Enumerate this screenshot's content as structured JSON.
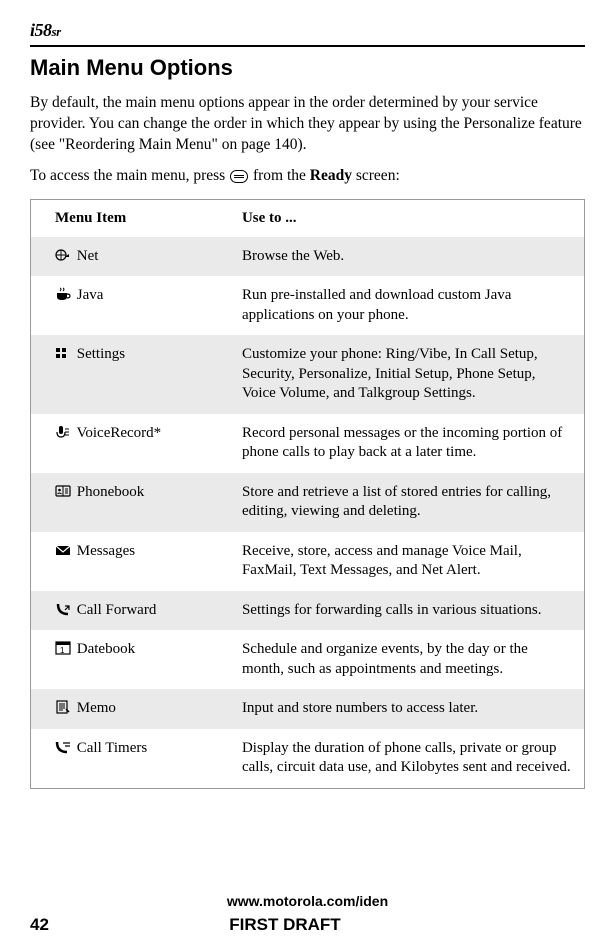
{
  "logo": {
    "main": "i58",
    "suffix": "sr"
  },
  "section_title": "Main Menu Options",
  "intro": "By default, the main menu options appear in the order determined by your service provider. You can change the order in which they appear by using the Personalize feature (see \"Reordering Main Menu\" on page 140).",
  "access_pre": "To access the main menu, press ",
  "access_post": " from the ",
  "access_bold": "Ready",
  "access_tail": " screen:",
  "table": {
    "head_item": "Menu Item",
    "head_use": "Use to ...",
    "rows": [
      {
        "label": "Net",
        "desc": "Browse the Web."
      },
      {
        "label": "Java",
        "desc": "Run pre-installed and download custom Java applications on your phone."
      },
      {
        "label": "Settings",
        "desc": "Customize your phone: Ring/Vibe, In Call Setup, Security, Personalize, Initial Setup, Phone Setup, Voice Volume, and Talkgroup Settings."
      },
      {
        "label": "VoiceRecord*",
        "desc": "Record personal messages or the incoming portion of phone calls to play back at a later time."
      },
      {
        "label": "Phonebook",
        "desc": "Store and retrieve a list of stored entries for calling, editing, viewing and deleting."
      },
      {
        "label": "Messages",
        "desc": "Receive, store, access and manage Voice Mail, FaxMail, Text Messages, and Net Alert."
      },
      {
        "label": "Call Forward",
        "desc": "Settings for forwarding calls in various situations."
      },
      {
        "label": "Datebook",
        "desc": "Schedule and organize events, by the day or the month, such as appointments and meetings."
      },
      {
        "label": "Memo",
        "desc": "Input and store numbers to access later."
      },
      {
        "label": "Call Timers",
        "desc": "Display the duration of phone calls, private or group calls, circuit data use, and Kilobytes sent and received."
      }
    ]
  },
  "footer": {
    "url": "www.motorola.com/iden",
    "page": "42",
    "status": "FIRST DRAFT"
  }
}
